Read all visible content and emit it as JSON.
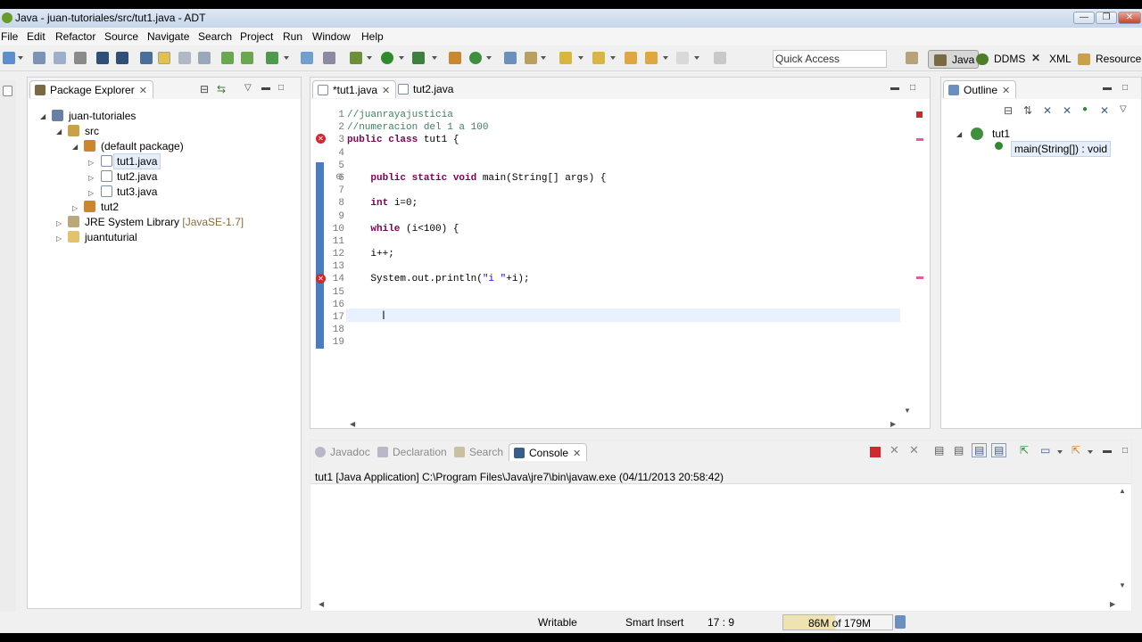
{
  "window": {
    "title": "Java - juan-tutoriales/src/tut1.java - ADT",
    "min": "—",
    "max": "❐",
    "close": "✕"
  },
  "menu": [
    "File",
    "Edit",
    "Refactor",
    "Source",
    "Navigate",
    "Search",
    "Project",
    "Run",
    "Window",
    "Help"
  ],
  "toolbar": {
    "quick_access": "Quick Access",
    "perspectives": [
      "Java",
      "DDMS",
      "XML",
      "Resource"
    ]
  },
  "package_explorer": {
    "tab": "Package Explorer",
    "nodes": [
      {
        "label": "juan-tutoriales"
      },
      {
        "label": "src"
      },
      {
        "label": "(default package)"
      },
      {
        "label": "tut1.java"
      },
      {
        "label": "tut2.java"
      },
      {
        "label": "tut3.java"
      },
      {
        "label": "tut2"
      },
      {
        "label": "JRE System Library",
        "suffix": "[JavaSE-1.7]"
      },
      {
        "label": "juantuturial"
      }
    ]
  },
  "editor": {
    "tabs": [
      "*tut1.java",
      "tut2.java"
    ],
    "line_numbers": [
      "1",
      "2",
      "3",
      "4",
      "5",
      "6",
      "7",
      "8",
      "9",
      "10",
      "11",
      "12",
      "13",
      "14",
      "15",
      "16",
      "17",
      "18",
      "19"
    ],
    "lines": [
      {
        "c1": "//juanrayajusticia"
      },
      {
        "c1": "//numeracion del 1 a 100"
      },
      {
        "k1": "public class",
        "t1": " tut1 {"
      },
      {},
      {},
      {
        "t0": "    ",
        "k1": "public static void",
        "t1": " main(String[] args) {"
      },
      {},
      {
        "t0": "    ",
        "k1": "int",
        "t1": " i=0;"
      },
      {},
      {
        "t0": "    ",
        "k1": "while",
        "t1": " (i<100) {"
      },
      {},
      {
        "t1": "    i++;"
      },
      {},
      {
        "t1": "    System.out.println(",
        "s1": "\"i \"",
        "t2": "+i);"
      },
      {},
      {},
      {},
      {},
      {}
    ]
  },
  "outline": {
    "tab": "Outline",
    "class_name": "tut1",
    "method": "main(String[]) : void"
  },
  "bottom": {
    "tabs": [
      "Javadoc",
      "Declaration",
      "Search",
      "Console"
    ],
    "console_header": "tut1 [Java Application] C:\\Program Files\\Java\\jre7\\bin\\javaw.exe (04/11/2013 20:58:42)"
  },
  "status": {
    "writable": "Writable",
    "insert": "Smart Insert",
    "position": "17 : 9",
    "heap": "86M of 179M"
  },
  "colors": {
    "keyword": "#7f0055",
    "comment": "#3f7f5f",
    "string": "#2a00ff",
    "current_line": "#e8f2fe",
    "error": "#d0282e"
  }
}
